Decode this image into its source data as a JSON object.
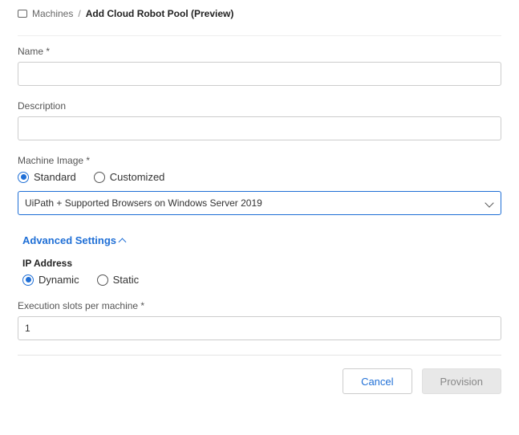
{
  "breadcrumb": {
    "root": "Machines",
    "separator": "/",
    "current": "Add Cloud Robot Pool (Preview)"
  },
  "form": {
    "name": {
      "label": "Name *",
      "value": ""
    },
    "description": {
      "label": "Description",
      "value": ""
    },
    "machineImage": {
      "label": "Machine Image *",
      "options": {
        "standard": "Standard",
        "customized": "Customized"
      },
      "selected": "standard",
      "dropdownValue": "UiPath + Supported Browsers on Windows Server 2019"
    },
    "advancedToggle": "Advanced Settings",
    "ipAddress": {
      "label": "IP Address",
      "options": {
        "dynamic": "Dynamic",
        "static": "Static"
      },
      "selected": "dynamic"
    },
    "executionSlots": {
      "label": "Execution slots per machine *",
      "value": "1"
    }
  },
  "footer": {
    "cancel": "Cancel",
    "provision": "Provision"
  }
}
